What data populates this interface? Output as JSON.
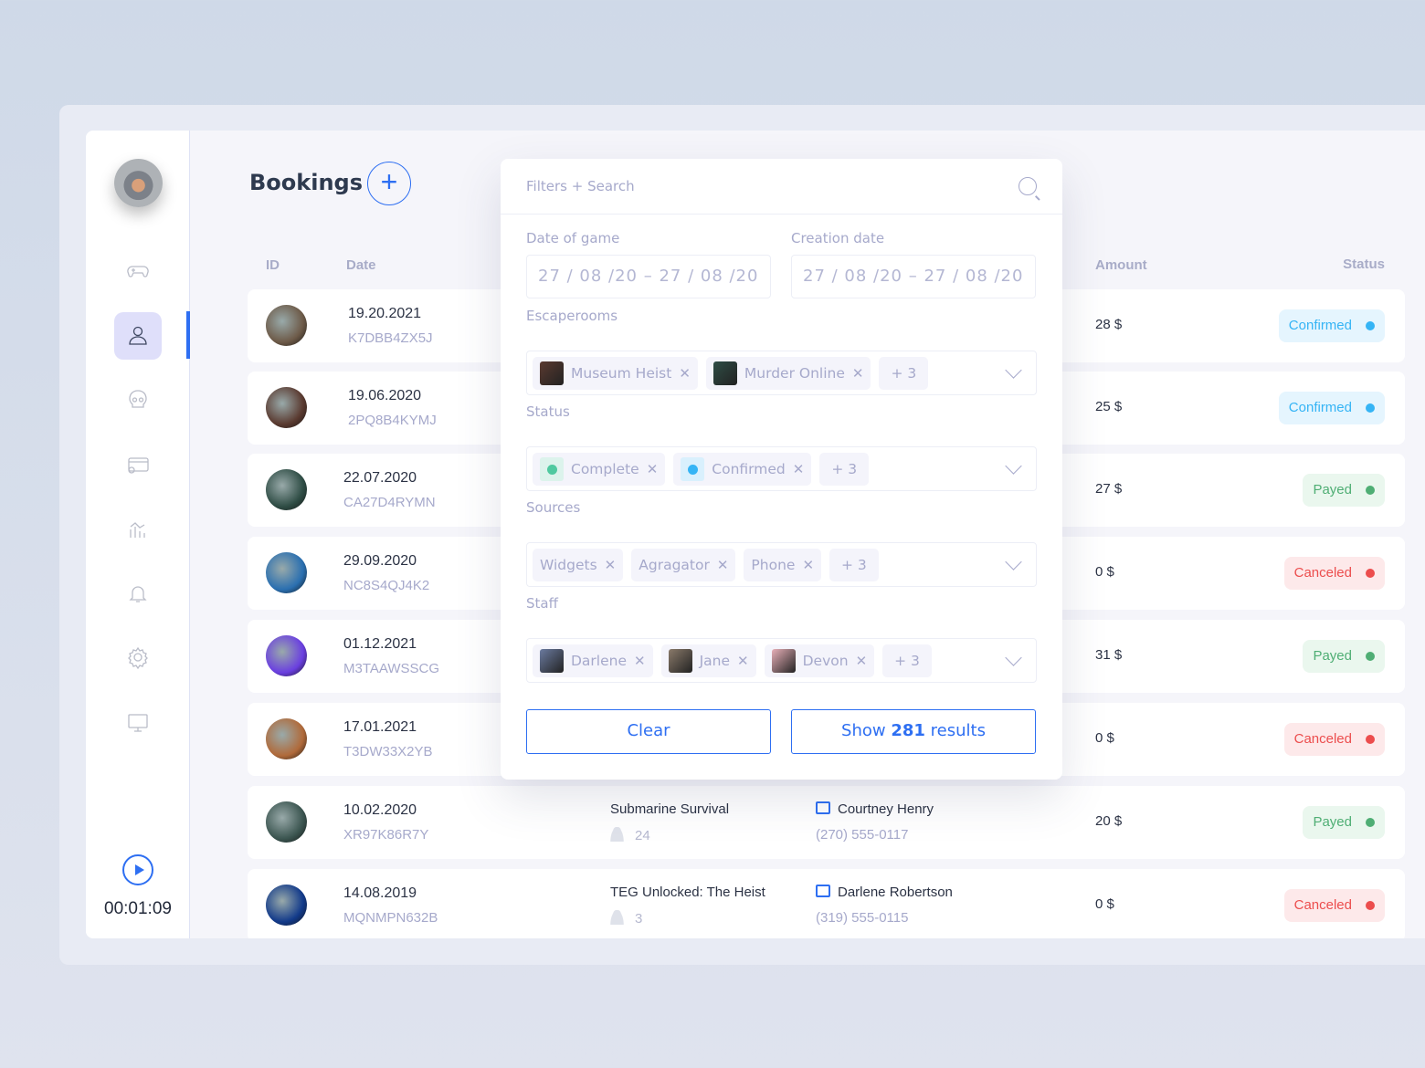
{
  "app": {
    "title": "Bookings",
    "add_label": "+",
    "timer": "00:01:09"
  },
  "sidebar": {
    "items": [
      {
        "icon": "gamepad-icon"
      },
      {
        "icon": "user-icon",
        "active": true
      },
      {
        "icon": "skull-icon"
      },
      {
        "icon": "payment-card-icon"
      },
      {
        "icon": "analytics-icon"
      },
      {
        "icon": "bell-icon"
      },
      {
        "icon": "gear-icon"
      },
      {
        "icon": "monitor-icon"
      }
    ]
  },
  "table": {
    "headers": {
      "id": "ID",
      "date": "Date",
      "amount": "Amount",
      "status": "Status"
    },
    "rows": [
      {
        "date": "19.20.2021",
        "id": "K7DBB4ZX5J",
        "room": "",
        "players": "",
        "staff": "",
        "phone": "",
        "amount": "28 $",
        "status": "Confirmed",
        "thumb": "#6d5a48"
      },
      {
        "date": "19.06.2020",
        "id": "2PQ8B4KYMJ",
        "room": "",
        "players": "",
        "staff": "",
        "phone": "",
        "amount": "25 $",
        "status": "Confirmed",
        "thumb": "#5a3a30"
      },
      {
        "date": "22.07.2020",
        "id": "CA27D4RYMN",
        "room": "",
        "players": "",
        "staff": "",
        "phone": "",
        "amount": "27 $",
        "status": "Payed",
        "thumb": "#2f4d45"
      },
      {
        "date": "29.09.2020",
        "id": "NC8S4QJ4K2",
        "room": "",
        "players": "",
        "staff": "",
        "phone": "",
        "amount": "0 $",
        "status": "Canceled",
        "thumb": "#2a6fb0"
      },
      {
        "date": "01.12.2021",
        "id": "M3TAAWSSCG",
        "room": "",
        "players": "",
        "staff": "",
        "phone": "",
        "amount": "31 $",
        "status": "Payed",
        "thumb": "#6a3fe0"
      },
      {
        "date": "17.01.2021",
        "id": "T3DW33X2YB",
        "room": "",
        "players": "",
        "staff": "",
        "phone": "",
        "amount": "0 $",
        "status": "Canceled",
        "thumb": "#b06a3a"
      },
      {
        "date": "10.02.2020",
        "id": "XR97K86R7Y",
        "room": "Submarine Survival",
        "players": "24",
        "staff": "Courtney Henry",
        "phone": "(270) 555-0117",
        "amount": "20 $",
        "status": "Payed",
        "thumb": "#3b5550"
      },
      {
        "date": "14.08.2019",
        "id": "MQNMPN632B",
        "room": "TEG Unlocked: The Heist",
        "players": "3",
        "staff": "Darlene Robertson",
        "phone": "(319) 555-0115",
        "amount": "0 $",
        "status": "Canceled",
        "thumb": "#123a8a"
      }
    ]
  },
  "status_colors": {
    "Confirmed": {
      "fg": "#35b4f5",
      "bg": "#e5f5fe"
    },
    "Payed": {
      "fg": "#4fae74",
      "bg": "#eaf7ee"
    },
    "Canceled": {
      "fg": "#ec4d4d",
      "bg": "#fde9ea"
    }
  },
  "filters": {
    "search_placeholder": "Filters + Search",
    "date_of_game": {
      "label": "Date of game",
      "value": "27 / 08 /20 – 27 / 08 /20"
    },
    "creation_date": {
      "label": "Creation date",
      "value": "27 / 08 /20 – 27 / 08 /20"
    },
    "escaperooms": {
      "label": "Escaperooms",
      "chips": [
        "Museum Heist",
        "Murder Online"
      ],
      "more": "+ 3"
    },
    "status": {
      "label": "Status",
      "chips": [
        "Complete",
        "Confirmed"
      ],
      "more": "+ 3"
    },
    "sources": {
      "label": "Sources",
      "chips": [
        "Widgets",
        "Agragator",
        "Phone"
      ],
      "more": "+ 3"
    },
    "staff": {
      "label": "Staff",
      "chips": [
        "Darlene",
        "Jane",
        "Devon"
      ],
      "more": "+ 3"
    },
    "clear_label": "Clear",
    "show_prefix": "Show ",
    "show_count": "281",
    "show_suffix": " results"
  }
}
